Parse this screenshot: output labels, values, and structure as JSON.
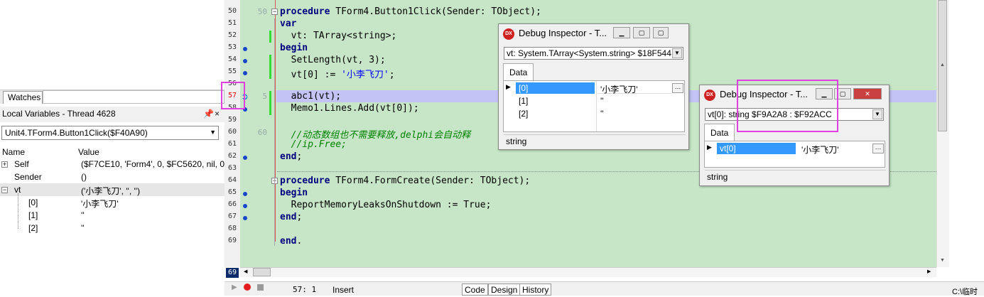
{
  "left_panel": {
    "watches_tab": "Watches",
    "local_vars_title": "Local Variables - Thread 4628",
    "thread_select": "Unit4.TForm4.Button1Click($F40A90)",
    "columns": [
      "Name",
      "Value"
    ],
    "rows": [
      {
        "name": "Self",
        "value": "($F7CE10, 'Form4', 0, $FC5620, nil, 0..."
      },
      {
        "name": "Sender",
        "value": "()"
      },
      {
        "name": "vt",
        "value": "('小李飞刀', '', '')"
      },
      {
        "name": "[0]",
        "value": "'小李飞刀'"
      },
      {
        "name": "[1]",
        "value": "''"
      },
      {
        "name": "[2]",
        "value": "''"
      }
    ]
  },
  "editor": {
    "line_numbers": [
      "50",
      "51",
      "52",
      "53",
      "54",
      "55",
      "56",
      "57",
      "58",
      "59",
      "60",
      "61",
      "62",
      "63",
      "64",
      "65",
      "66",
      "67",
      "68",
      "69"
    ],
    "tick_labels": {
      "50": "50",
      "57": "5",
      "60": "60"
    },
    "lines": [
      "procedure TForm4.Button1Click(Sender: TObject);",
      "var",
      "  vt: TArray<string>;",
      "begin",
      "  SetLength(vt, 3);",
      "  vt[0] := '小李飞刀';",
      "",
      "  abc1(vt);",
      "  Memo1.Lines.Add(vt[0]);",
      "",
      "  //动态数组也不需要释放,delphi会自动释",
      "  //ip.Free;",
      "end;",
      "",
      "procedure TForm4.FormCreate(Sender: TObject);",
      "begin",
      "  ReportMemoryLeaksOnShutdown := True;",
      "end;",
      "",
      "end."
    ],
    "line_69_badge": "69"
  },
  "status": {
    "position": "57:  1",
    "mode": "Insert",
    "tabs": [
      "Code",
      "Design",
      "History"
    ],
    "right_text": "C:\\临时"
  },
  "inspector1": {
    "title": "Debug Inspector - T...",
    "combo": "vt: System.TArray<System.string> $18F544 :",
    "tab": "Data",
    "rows": [
      {
        "name": "[0]",
        "value": "'小李飞刀'"
      },
      {
        "name": "[1]",
        "value": "''"
      },
      {
        "name": "[2]",
        "value": "''"
      }
    ],
    "type": "string"
  },
  "inspector2": {
    "title": "Debug Inspector - T...",
    "combo": "vt[0]: string $F9A2A8 : $F92ACC",
    "tab": "Data",
    "rows": [
      {
        "name": "vt[0]",
        "value": "'小李飞刀'"
      }
    ],
    "type": "string"
  }
}
